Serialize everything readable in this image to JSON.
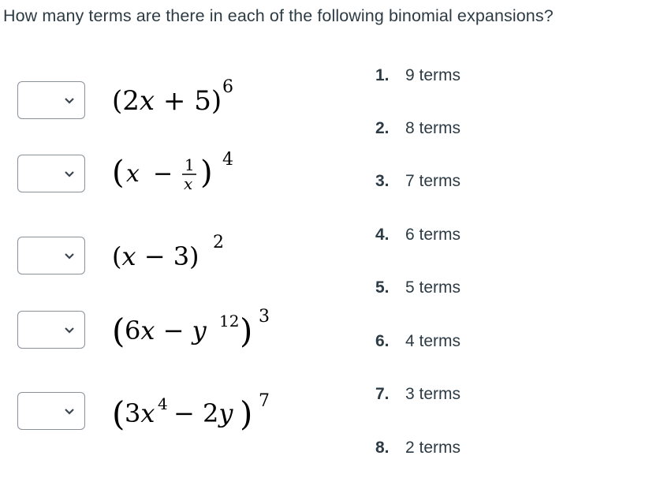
{
  "question": "How many terms are there in each of the following binomial expansions?",
  "matches": [
    {
      "expression": "(2x + 5)^6",
      "base": "(2x + 5)",
      "exponent": "6",
      "selected": ""
    },
    {
      "expression": "(x - 1/x)^4",
      "base": "(x − 1/x)",
      "exponent": "4",
      "selected": ""
    },
    {
      "expression": "(x - 3)^2",
      "base": "(x − 3)",
      "exponent": "2",
      "selected": ""
    },
    {
      "expression": "(6x - y^12)^3",
      "base": "(6x − y^12)",
      "exponent": "3",
      "selected": ""
    },
    {
      "expression": "(3x^4 - 2y)^7",
      "base": "(3x^4 − 2y)",
      "exponent": "7",
      "selected": ""
    }
  ],
  "options": [
    {
      "num": "1.",
      "label": "9 terms"
    },
    {
      "num": "2.",
      "label": "8 terms"
    },
    {
      "num": "3.",
      "label": "7 terms"
    },
    {
      "num": "4.",
      "label": "6 terms"
    },
    {
      "num": "5.",
      "label": "5 terms"
    },
    {
      "num": "6.",
      "label": "4 terms"
    },
    {
      "num": "7.",
      "label": "3 terms"
    },
    {
      "num": "8.",
      "label": "2 terms"
    }
  ],
  "icons": {
    "select_arrow": "chevron-down-icon"
  }
}
